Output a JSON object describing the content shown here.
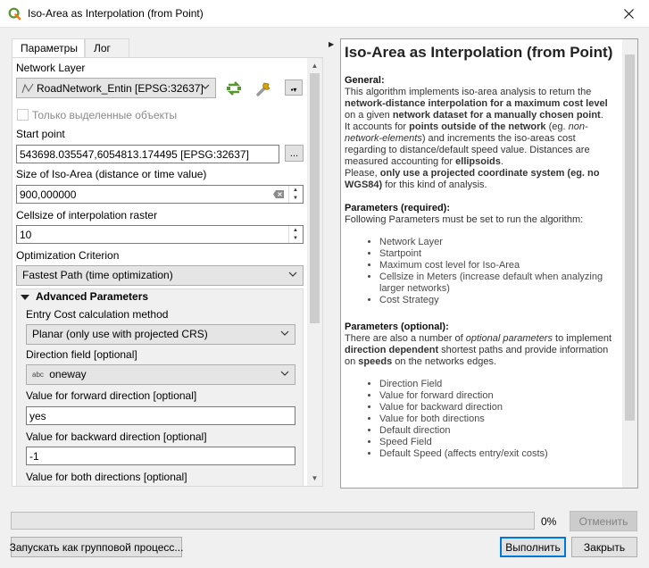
{
  "window": {
    "title": "Iso-Area as Interpolation (from Point)"
  },
  "tabs": [
    "Параметры",
    "Лог"
  ],
  "form": {
    "network_layer_label": "Network Layer",
    "network_layer_value": "RoadNetwork_Entin [EPSG:32637]",
    "selected_only_label": "Только выделенные объекты",
    "start_point_label": "Start point",
    "start_point_value": "543698.035547,6054813.174495 [EPSG:32637]",
    "iso_size_label": "Size of Iso-Area (distance or time value)",
    "iso_size_value": "900,000000",
    "cellsize_label": "Cellsize of interpolation raster",
    "cellsize_value": "10",
    "optimization_label": "Optimization Criterion",
    "optimization_value": "Fastest Path (time optimization)",
    "advanced_label": "Advanced Parameters",
    "entry_cost_label": "Entry Cost calculation method",
    "entry_cost_value": "Planar (only use with projected CRS)",
    "direction_field_label": "Direction field [optional]",
    "direction_field_type": "abc",
    "direction_field_value": "oneway",
    "forward_label": "Value for forward direction [optional]",
    "forward_value": "yes",
    "backward_label": "Value for backward direction [optional]",
    "backward_value": "-1",
    "both_label": "Value for both directions [optional]",
    "browse_label": "..."
  },
  "help": {
    "title": "Iso-Area as Interpolation (from Point)",
    "general_heading": "General:",
    "general_1a": "This algorithm implements iso-area analysis to return the ",
    "general_1b": "network-distance interpolation for a maximum cost level",
    "general_1c": " on a given ",
    "general_1d": "network dataset for a manually chosen point",
    "general_1e": ".",
    "general_2a": "It accounts for ",
    "general_2b": "points outside of the network",
    "general_2c": " (eg. ",
    "general_2d": "non-network-elements",
    "general_2e": ") and increments the iso-areas cost regarding to distance/default speed value. Distances are measured accounting for ",
    "general_2f": "ellipsoids",
    "general_2g": ".",
    "general_3a": "Please, ",
    "general_3b": "only use a projected coordinate system (eg. no WGS84)",
    "general_3c": " for this kind of analysis.",
    "required_heading": "Parameters (required):",
    "required_text": "Following Parameters must be set to run the algorithm:",
    "required_items": [
      "Network Layer",
      "Startpoint",
      "Maximum cost level for Iso-Area",
      "Cellsize in Meters (increase default when analyzing larger networks)",
      "Cost Strategy"
    ],
    "optional_heading": "Parameters (optional):",
    "optional_a": "There are also a number of ",
    "optional_b": "optional parameters",
    "optional_c": " to implement ",
    "optional_d": "direction dependent",
    "optional_e": " shortest paths and provide information on ",
    "optional_f": "speeds",
    "optional_g": " on the networks edges.",
    "optional_items": [
      "Direction Field",
      "Value for forward direction",
      "Value for backward direction",
      "Value for both directions",
      "Default direction",
      "Speed Field",
      "Default Speed (affects entry/exit costs)"
    ]
  },
  "footer": {
    "progress_text": "0%",
    "progress": 0,
    "cancel_label": "Отменить",
    "batch_label": "Запускать как групповой процесс...",
    "run_label": "Выполнить",
    "close_label": "Закрыть"
  },
  "colors": {
    "accent": "#0078d7",
    "qgis_green": "#589632",
    "qgis_yellow": "#ee7913"
  }
}
